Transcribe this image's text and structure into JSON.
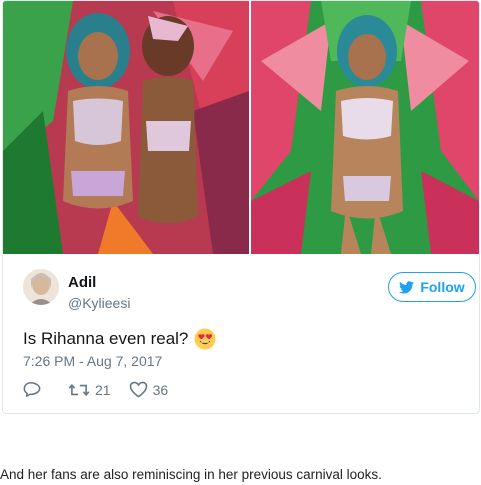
{
  "tweet": {
    "author_name": "Adil",
    "author_handle": "@Kylieesi",
    "follow_label": "Follow",
    "text": "Is Rihanna even real?",
    "emoji": "heart-eyes-emoji",
    "timestamp": "7:26 PM - Aug 7, 2017",
    "retweet_count": "21",
    "like_count": "36",
    "accent_color": "#1da1f2",
    "icons": [
      "twitter-bird-icon",
      "reply-icon",
      "retweet-icon",
      "heart-icon"
    ]
  },
  "media": {
    "photos": [
      "carnival-photo-left",
      "carnival-photo-right"
    ]
  },
  "caption": "And her fans are also reminiscing in her previous carnival looks."
}
